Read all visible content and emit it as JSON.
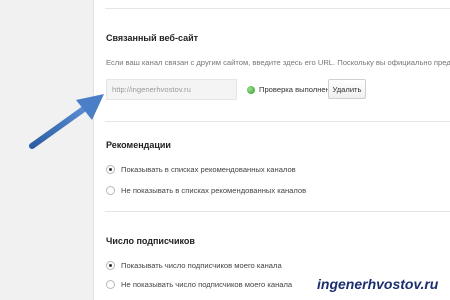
{
  "linked_site": {
    "title": "Связанный веб-сайт",
    "description": "Если ваш канал связан с другим сайтом, введите здесь его URL. Поскольку вы официально представляете свой",
    "url_value": "http://ingenerhvostov.ru",
    "verify_text": "Проверка выполнена",
    "remove_label": "Удалить",
    "status_color": "#2f9b2a"
  },
  "recommendations": {
    "title": "Рекомендации",
    "options": [
      {
        "label": "Показывать в списках рекомендованных каналов",
        "checked": true
      },
      {
        "label": "Не показывать в списках рекомендованных каналов",
        "checked": false
      }
    ]
  },
  "subscribers": {
    "title": "Число подписчиков",
    "options": [
      {
        "label": "Показывать число подписчиков моего канала",
        "checked": true
      },
      {
        "label": "Не показывать число подписчиков моего канала",
        "checked": false
      }
    ]
  },
  "annotation": {
    "arrow_icon": "arrow-pointer-icon",
    "arrow_color": "#3b6fb6",
    "watermark": "ingenerhvostov.ru"
  }
}
